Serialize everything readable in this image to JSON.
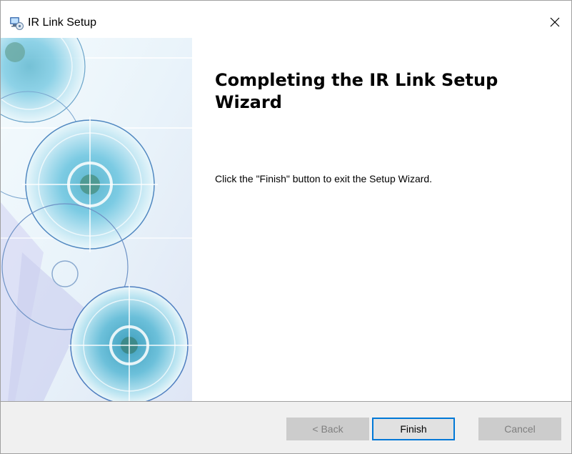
{
  "window": {
    "title": "IR Link Setup",
    "close_glyph": "✕"
  },
  "content": {
    "heading": "Completing the IR Link Setup Wizard",
    "message": "Click the \"Finish\" button to exit the Setup Wizard."
  },
  "buttons": {
    "back": "< Back",
    "finish": "Finish",
    "cancel": "Cancel"
  },
  "states": {
    "back_enabled": false,
    "finish_enabled": true,
    "cancel_enabled": false
  },
  "icons": {
    "app": "installer-computer-icon",
    "close": "close-icon",
    "banner": "decorative-disc-artwork"
  },
  "colors": {
    "accent": "#0078d7",
    "footer_bg": "#f0f0f0",
    "disabled_button": "#cccccc",
    "disabled_text": "#7f7f7f"
  }
}
